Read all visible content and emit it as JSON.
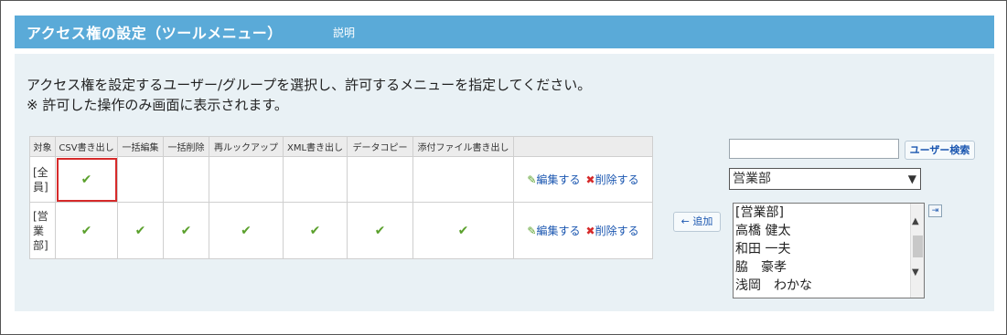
{
  "header": {
    "title": "アクセス権の設定（ツールメニュー）",
    "help": "説明"
  },
  "desc": {
    "line1": "アクセス権を設定するユーザー/グループを選択し、許可するメニューを指定してください。",
    "line2": "※ 許可した操作のみ画面に表示されます。"
  },
  "table": {
    "headers": [
      "対象",
      "CSV書き出し",
      "一括編集",
      "一括削除",
      "再ルックアップ",
      "XML書き出し",
      "データコピー",
      "添付ファイル書き出し",
      ""
    ],
    "rows": [
      {
        "target": "[全員]",
        "checks": [
          true,
          false,
          false,
          false,
          false,
          false,
          false
        ]
      },
      {
        "target": "[営業部]",
        "checks": [
          true,
          true,
          true,
          true,
          true,
          true,
          true
        ]
      }
    ],
    "edit_label": "編集する",
    "delete_label": "削除する",
    "check_glyph": "✔"
  },
  "add_button": "← 追加",
  "search": {
    "value": "",
    "button": "ユーザー検索"
  },
  "group_select": {
    "selected": "営業部"
  },
  "members": [
    "[営業部]",
    "高橋 健太",
    "和田 一夫",
    "脇　豪孝",
    "浅岡　わかな"
  ],
  "colors": {
    "header": "#5aaad8",
    "panel": "#e9f1f5",
    "check": "#5aa02c",
    "highlight": "#d62a2a",
    "link": "#1a56b0"
  }
}
